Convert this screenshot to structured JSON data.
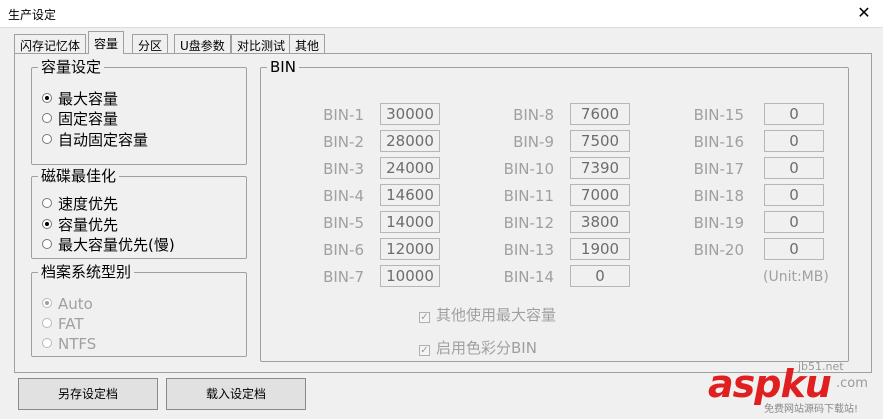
{
  "window": {
    "title": "生产设定",
    "close_glyph": "✕"
  },
  "tabs": [
    "闪存记忆体",
    "容量",
    "分区",
    "U盘参数",
    "对比测试",
    "其他"
  ],
  "capacity_group": {
    "title": "容量设定",
    "options": [
      "最大容量",
      "固定容量",
      "自动固定容量"
    ],
    "selected": 0
  },
  "disk_group": {
    "title": "磁碟最佳化",
    "options": [
      "速度优先",
      "容量优先",
      "最大容量优先(慢)"
    ],
    "selected": 1
  },
  "fs_group": {
    "title": "档案系统型别",
    "options": [
      "Auto",
      "FAT",
      "NTFS"
    ],
    "selected": 0
  },
  "bin_group": {
    "title": "BIN",
    "columns": [
      [
        {
          "label": "BIN-1",
          "value": "30000"
        },
        {
          "label": "BIN-2",
          "value": "28000"
        },
        {
          "label": "BIN-3",
          "value": "24000"
        },
        {
          "label": "BIN-4",
          "value": "14600"
        },
        {
          "label": "BIN-5",
          "value": "14000"
        },
        {
          "label": "BIN-6",
          "value": "12000"
        },
        {
          "label": "BIN-7",
          "value": "10000"
        }
      ],
      [
        {
          "label": "BIN-8",
          "value": "7600"
        },
        {
          "label": "BIN-9",
          "value": "7500"
        },
        {
          "label": "BIN-10",
          "value": "7390"
        },
        {
          "label": "BIN-11",
          "value": "7000"
        },
        {
          "label": "BIN-12",
          "value": "3800"
        },
        {
          "label": "BIN-13",
          "value": "1900"
        },
        {
          "label": "BIN-14",
          "value": "0"
        }
      ],
      [
        {
          "label": "BIN-15",
          "value": "0"
        },
        {
          "label": "BIN-16",
          "value": "0"
        },
        {
          "label": "BIN-17",
          "value": "0"
        },
        {
          "label": "BIN-18",
          "value": "0"
        },
        {
          "label": "BIN-19",
          "value": "0"
        },
        {
          "label": "BIN-20",
          "value": "0"
        }
      ]
    ],
    "unit": "(Unit:MB)",
    "checkbox_max_capacity": "其他使用最大容量",
    "checkbox_color_bin": "启用色彩分BIN",
    "check_glyph": "✓"
  },
  "buttons": {
    "save": "另存设定档",
    "load": "载入设定档"
  },
  "watermark": {
    "brand": "aspku",
    "tld": ".com",
    "site": "jb51.net",
    "tagline": "免费网站源码下载站!"
  },
  "colors": {
    "disabled_text": "#a0a0a0",
    "border": "#a0a0a0",
    "watermark_red": "#e02020"
  }
}
